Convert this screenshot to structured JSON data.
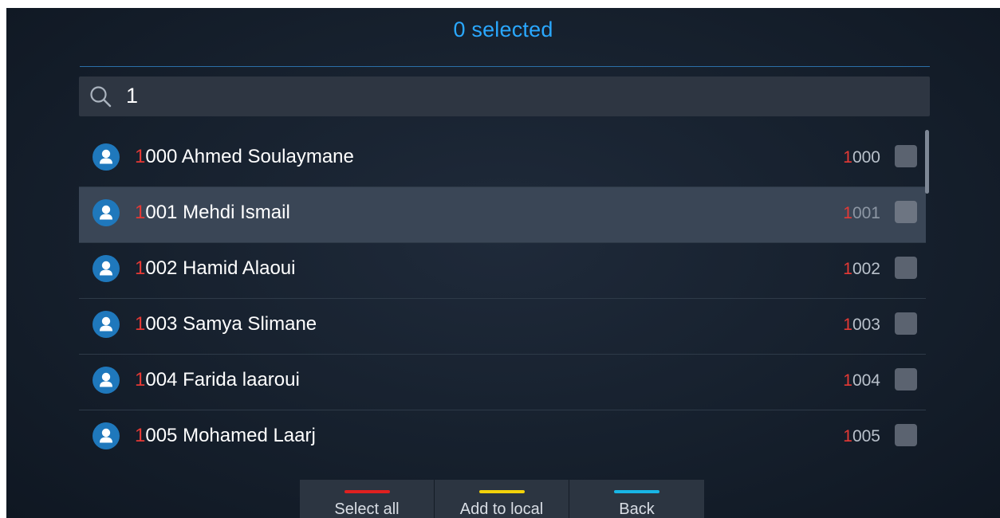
{
  "header": {
    "title": "0 selected"
  },
  "search": {
    "query": "1",
    "icon": "search-icon"
  },
  "contacts": [
    {
      "highlight": "1",
      "rest_name": "000 Ahmed Soulaymane",
      "num_highlight": "1",
      "num_rest": "000",
      "checked": false,
      "focused": false
    },
    {
      "highlight": "1",
      "rest_name": "001 Mehdi Ismail",
      "num_highlight": "1",
      "num_rest": "001",
      "checked": false,
      "focused": true
    },
    {
      "highlight": "1",
      "rest_name": "002 Hamid Alaoui",
      "num_highlight": "1",
      "num_rest": "002",
      "checked": false,
      "focused": false
    },
    {
      "highlight": "1",
      "rest_name": "003 Samya Slimane",
      "num_highlight": "1",
      "num_rest": "003",
      "checked": false,
      "focused": false
    },
    {
      "highlight": "1",
      "rest_name": "004 Farida laaroui",
      "num_highlight": "1",
      "num_rest": "004",
      "checked": false,
      "focused": false
    },
    {
      "highlight": "1",
      "rest_name": "005 Mohamed Laarj",
      "num_highlight": "1",
      "num_rest": "005",
      "checked": false,
      "focused": false
    }
  ],
  "softkeys": [
    {
      "label": "Select all",
      "color": "#e0201f"
    },
    {
      "label": "Add to local",
      "color": "#f2d20a"
    },
    {
      "label": "Back",
      "color": "#18b6e6"
    }
  ],
  "colors": {
    "accent": "#2aa8ff",
    "match_highlight": "#e53935",
    "avatar": "#1f78bc"
  }
}
